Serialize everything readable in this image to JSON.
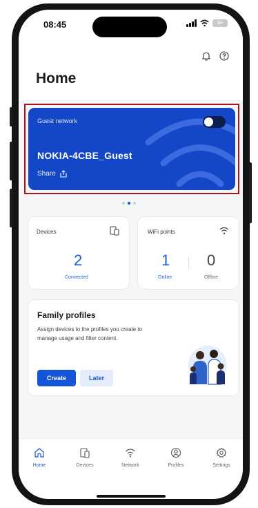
{
  "status": {
    "time": "08:45",
    "battery": "3+"
  },
  "header": {
    "title": "Home",
    "icons": [
      "bell-icon",
      "help-icon"
    ]
  },
  "guest": {
    "label": "Guest network",
    "ssid": "NOKIA-4CBE_Guest",
    "share_label": "Share",
    "enabled": false
  },
  "carousel": {
    "count": 3,
    "active": 1
  },
  "devices": {
    "label": "Devices",
    "count": "2",
    "status": "Connected"
  },
  "wifi_points": {
    "label": "WiFi points",
    "online_count": "1",
    "online_label": "Online",
    "offline_count": "0",
    "offline_label": "Offline"
  },
  "family": {
    "title": "Family profiles",
    "text": "Assign devices to the profiles you create to manage usage and filter content.",
    "create_label": "Create",
    "later_label": "Later"
  },
  "tabs": [
    {
      "label": "Home",
      "icon": "home-icon",
      "active": true
    },
    {
      "label": "Devices",
      "icon": "devices-icon",
      "active": false
    },
    {
      "label": "Network",
      "icon": "wifi-icon",
      "active": false
    },
    {
      "label": "Profiles",
      "icon": "profile-icon",
      "active": false
    },
    {
      "label": "Settings",
      "icon": "gear-icon",
      "active": false
    }
  ],
  "colors": {
    "accent": "#1455d9",
    "guest_card": "#1446c8",
    "highlight_border": "#a8121b"
  }
}
